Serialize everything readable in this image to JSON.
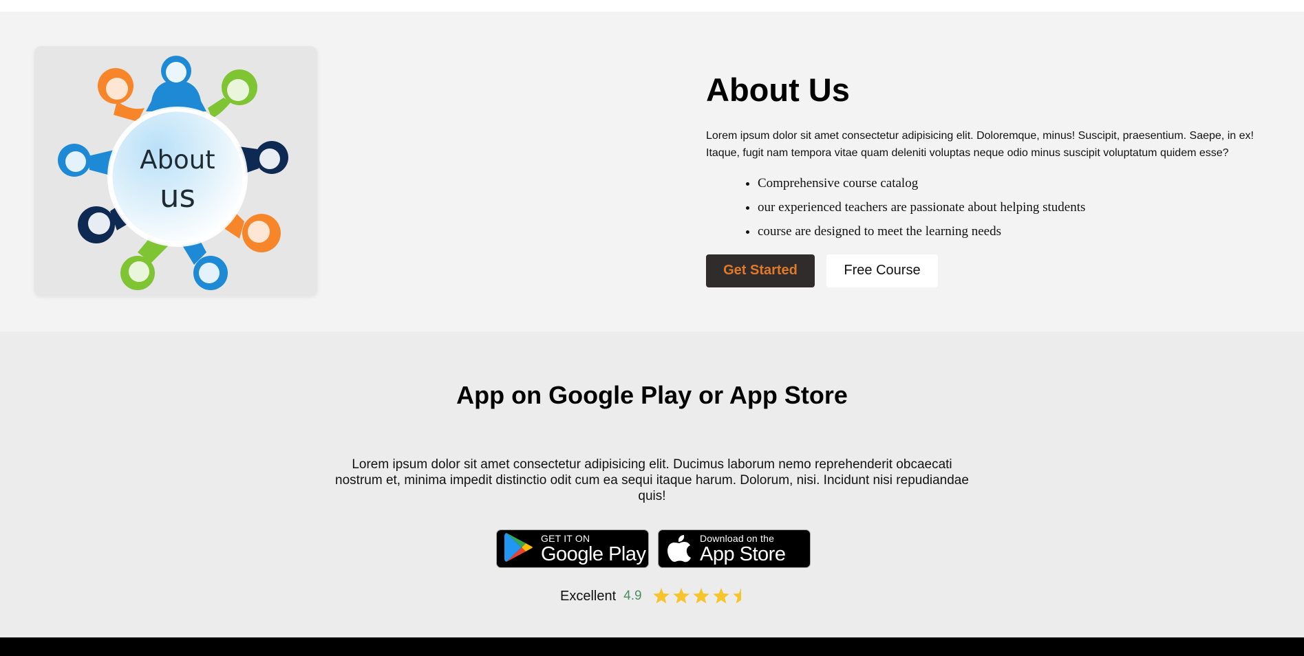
{
  "about": {
    "image_text_line1": "About",
    "image_text_line2": "us",
    "title": "About Us",
    "description": "Lorem ipsum dolor sit amet consectetur adipisicing elit. Doloremque, minus! Suscipit, praesentium. Saepe, in ex! Itaque, fugit nam tempora vitae quam deleniti voluptas neque odio minus suscipit voluptatum quidem esse?",
    "features": [
      "Comprehensive course catalog",
      "our experienced teachers are passionate about helping students",
      "course are designed to meet the learning needs"
    ],
    "primary_button": "Get Started",
    "secondary_button": "Free Course"
  },
  "app": {
    "title": "App on Google Play or App Store",
    "description": "Lorem ipsum dolor sit amet consectetur adipisicing elit. Ducimus laborum nemo reprehenderit obcaecati nostrum et, minima impedit distinctio odit cum ea sequi itaque harum. Dolorum, nisi. Incidunt nisi repudiandae quis!",
    "google_play": {
      "small": "GET IT ON",
      "big": "Google Play"
    },
    "app_store": {
      "small": "Download on the",
      "big": "App Store"
    },
    "rating": {
      "label": "Excellent",
      "value": "4.9",
      "stars": 4.5
    }
  },
  "colors": {
    "about_bg": "#f3f3f3",
    "app_bg": "#ececec",
    "primary_button_bg": "#2f2c2b",
    "primary_button_text": "#e07a2a",
    "rating_value": "#4d8c5e",
    "star": "#f7c52b",
    "footer": "#000000"
  }
}
